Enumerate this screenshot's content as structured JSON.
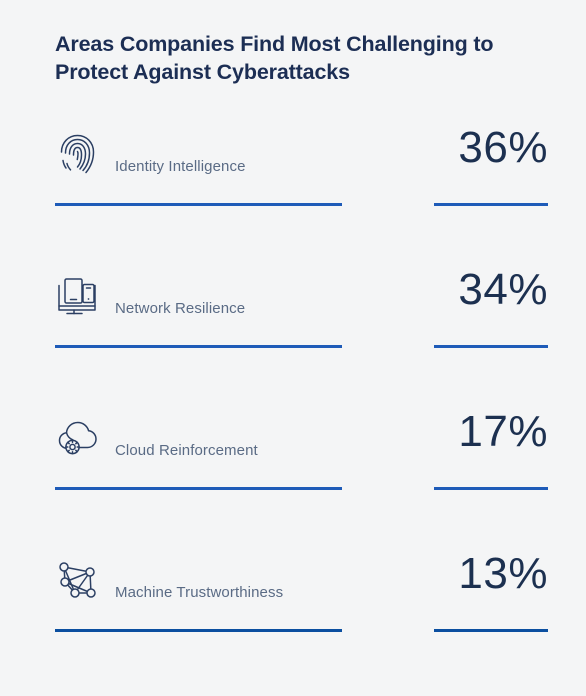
{
  "page": {
    "title": "Areas Companies Find Most Challenging to Protect Against Cyberattacks",
    "background_color": "#f4f5f6",
    "title_color": "#1c2e54",
    "label_color": "#5a6b85",
    "value_color": "#1c3050",
    "rule_color": "#1e5bb8"
  },
  "chart_data": {
    "type": "bar",
    "title": "Areas Companies Find Most Challenging to Protect Against Cyberattacks",
    "xlabel": "",
    "ylabel": "",
    "categories": [
      "Identity Intelligence",
      "Network Resilience",
      "Cloud Reinforcement",
      "Machine Trustworthiness"
    ],
    "values": [
      36,
      34,
      17,
      13
    ],
    "value_labels": [
      "36%",
      "34%",
      "17%",
      "13%"
    ],
    "unit": "%",
    "ylim": [
      0,
      100
    ],
    "grid": false,
    "legend": "none"
  },
  "rows": [
    {
      "icon": "fingerprint-icon",
      "label": "Identity Intelligence",
      "value": "36%"
    },
    {
      "icon": "devices-icon",
      "label": "Network Resilience",
      "value": "34%"
    },
    {
      "icon": "cloud-gear-icon",
      "label": "Cloud Reinforcement",
      "value": "17%"
    },
    {
      "icon": "network-nodes-icon",
      "label": "Machine Trustworthiness",
      "value": "13%"
    }
  ]
}
